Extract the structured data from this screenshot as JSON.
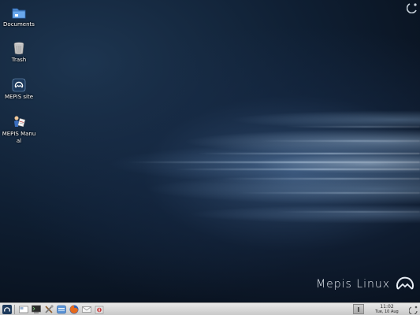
{
  "desktop": {
    "icons": [
      {
        "label": "Documents",
        "icon": "folder-icon"
      },
      {
        "label": "Trash",
        "icon": "trash-icon"
      },
      {
        "label": "MEPIS site",
        "icon": "mepis-site-icon"
      },
      {
        "label": "MEPIS Manual",
        "icon": "manual-icon"
      }
    ],
    "brand_text": "Mepis Linux"
  },
  "taskbar": {
    "launchers": [
      "mepis-menu-icon",
      "desktop-pager-icon",
      "terminal-icon",
      "tools-icon",
      "file-manager-icon",
      "firefox-icon",
      "mail-icon",
      "software-icon"
    ],
    "clock": {
      "time": "11:02",
      "date": "Tue, 10 Aug"
    }
  },
  "colors": {
    "wallpaper_dark": "#09121f",
    "wallpaper_mid": "#1d3550",
    "taskbar": "#d8d8d8"
  }
}
